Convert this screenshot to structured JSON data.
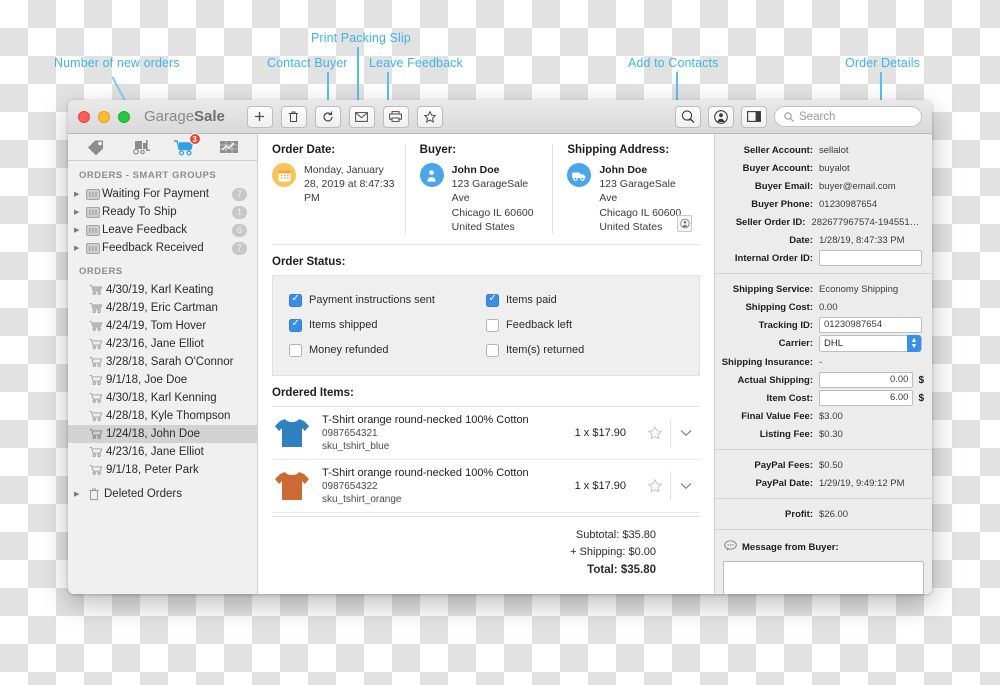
{
  "annotations": [
    {
      "id": "new-orders",
      "label": "Number of new orders"
    },
    {
      "id": "contact-buyer",
      "label": "Contact Buyer"
    },
    {
      "id": "print-packing-slip",
      "label": "Print Packing Slip"
    },
    {
      "id": "leave-feedback",
      "label": "Leave Feedback"
    },
    {
      "id": "add-to-contacts",
      "label": "Add to Contacts"
    },
    {
      "id": "order-details",
      "label": "Order Details"
    }
  ],
  "window": {
    "app_title_light": "Garage",
    "app_title_bold": "Sale",
    "toolbar_buttons": [
      {
        "name": "add-button",
        "glyph": "+"
      },
      {
        "name": "delete-button",
        "glyph": "🗑"
      },
      {
        "name": "refresh-button",
        "glyph": "⟳"
      },
      {
        "name": "contact-buyer-button",
        "glyph": "✉"
      },
      {
        "name": "print-packing-slip-button",
        "glyph": "🖶"
      },
      {
        "name": "leave-feedback-button",
        "glyph": "☆"
      }
    ],
    "right_buttons": [
      {
        "name": "search-scope-button",
        "glyph": "◔"
      },
      {
        "name": "add-to-contacts-button",
        "glyph": "◉"
      },
      {
        "name": "toggle-inspector-button",
        "glyph": "▯"
      }
    ],
    "search": {
      "placeholder": "Search",
      "value": ""
    }
  },
  "sidebar": {
    "tabs": [
      {
        "name": "tab-listings",
        "icon": "price-tag-icon",
        "active": false,
        "badge": ""
      },
      {
        "name": "tab-shipping",
        "icon": "forklift-icon",
        "active": false,
        "badge": ""
      },
      {
        "name": "tab-orders",
        "icon": "shopping-cart-icon",
        "active": true,
        "badge": "3"
      },
      {
        "name": "tab-statistics",
        "icon": "chart-icon",
        "active": false,
        "badge": ""
      }
    ],
    "smart_groups_header": "ORDERS - SMART GROUPS",
    "smart_groups": [
      {
        "label": "Waiting For Payment",
        "count": "7"
      },
      {
        "label": "Ready To Ship",
        "count": "1"
      },
      {
        "label": "Leave Feedback",
        "count": "6"
      },
      {
        "label": "Feedback Received",
        "count": "7"
      }
    ],
    "orders_header": "ORDERS",
    "orders": [
      {
        "label": "4/30/19, Karl Keating",
        "selected": false,
        "filled": true
      },
      {
        "label": "4/28/19, Eric Cartman",
        "selected": false,
        "filled": true
      },
      {
        "label": "4/24/19, Tom Hover",
        "selected": false,
        "filled": true
      },
      {
        "label": "4/23/16, Jane Elliot",
        "selected": false,
        "filled": false
      },
      {
        "label": "3/28/18, Sarah O'Connor",
        "selected": false,
        "filled": false
      },
      {
        "label": "9/1/18, Joe Doe",
        "selected": false,
        "filled": false
      },
      {
        "label": "4/30/18, Karl Kenning",
        "selected": false,
        "filled": false
      },
      {
        "label": "4/28/18, Kyle Thompson",
        "selected": false,
        "filled": false
      },
      {
        "label": "1/24/18, John Doe",
        "selected": true,
        "filled": false
      },
      {
        "label": "4/23/16, Jane Elliot",
        "selected": false,
        "filled": false
      },
      {
        "label": "9/1/18, Peter Park",
        "selected": false,
        "filled": false
      }
    ],
    "deleted_orders": "Deleted Orders"
  },
  "main": {
    "order_date": {
      "title": "Order Date:",
      "value": "Monday, January 28, 2019 at 8:47:33 PM"
    },
    "buyer": {
      "title": "Buyer:",
      "name": "John Doe",
      "line1": "123 GarageSale Ave",
      "line2": "Chicago IL 60600",
      "line3": "United States"
    },
    "shipping_address": {
      "title": "Shipping Address:",
      "name": "John Doe",
      "line1": "123 GarageSale Ave",
      "line2": "Chicago IL 60600",
      "line3": "United States"
    },
    "order_status_title": "Order Status:",
    "status_left": [
      {
        "label": "Payment instructions sent",
        "checked": true
      },
      {
        "label": "Items shipped",
        "checked": true
      },
      {
        "label": "Money refunded",
        "checked": false
      }
    ],
    "status_right": [
      {
        "label": "Items paid",
        "checked": true
      },
      {
        "label": "Feedback left",
        "checked": false
      },
      {
        "label": "Item(s) returned",
        "checked": false
      }
    ],
    "ordered_items_title": "Ordered Items:",
    "items": [
      {
        "name": "T-Shirt orange round-necked 100% Cotton",
        "id": "0987654321",
        "sku": "sku_tshirt_blue",
        "price": "1 x $17.90",
        "color": "#2e80bf"
      },
      {
        "name": "T-Shirt orange round-necked 100% Cotton",
        "id": "0987654322",
        "sku": "sku_tshirt_orange",
        "price": "1 x $17.90",
        "color": "#cc6a33"
      }
    ],
    "totals": {
      "subtotal": "Subtotal: $35.80",
      "shipping": "+ Shipping: $0.00",
      "total": "Total: $35.80"
    }
  },
  "inspector": {
    "group1": [
      {
        "label": "Seller Account:",
        "value": "sellalot",
        "type": "text"
      },
      {
        "label": "Buyer Account:",
        "value": "buyalot",
        "type": "text"
      },
      {
        "label": "Buyer Email:",
        "value": "buyer@email.com",
        "type": "text"
      },
      {
        "label": "Buyer Phone:",
        "value": "01230987654",
        "type": "text"
      },
      {
        "label": "Seller Order ID:",
        "value": "282677967574-194551513...",
        "type": "text"
      },
      {
        "label": "Date:",
        "value": "1/28/19, 8:47:33 PM",
        "type": "text"
      },
      {
        "label": "Internal Order ID:",
        "value": "",
        "type": "field"
      }
    ],
    "group2": [
      {
        "label": "Shipping Service:",
        "value": "Economy Shipping",
        "type": "text"
      },
      {
        "label": "Shipping Cost:",
        "value": "0.00",
        "type": "text"
      },
      {
        "label": "Tracking ID:",
        "value": "01230987654",
        "type": "field"
      },
      {
        "label": "Carrier:",
        "value": "DHL",
        "type": "popup"
      },
      {
        "label": "Shipping Insurance:",
        "value": "-",
        "type": "text"
      },
      {
        "label": "Actual Shipping:",
        "value": "0.00",
        "type": "money"
      },
      {
        "label": "Item Cost:",
        "value": "6.00",
        "type": "money"
      },
      {
        "label": "Final Value Fee:",
        "value": "$3.00",
        "type": "text"
      },
      {
        "label": "Listing Fee:",
        "value": "$0.30",
        "type": "text"
      }
    ],
    "group3": [
      {
        "label": "PayPal Fees:",
        "value": "$0.50",
        "type": "text"
      },
      {
        "label": "PayPal Date:",
        "value": "1/29/19, 9:49:12 PM",
        "type": "text"
      }
    ],
    "group4": [
      {
        "label": "Profit:",
        "value": "$26.00",
        "type": "text"
      }
    ],
    "message_from_buyer": {
      "label": "Message from Buyer:",
      "value": ""
    },
    "currency_symbol": "$"
  }
}
